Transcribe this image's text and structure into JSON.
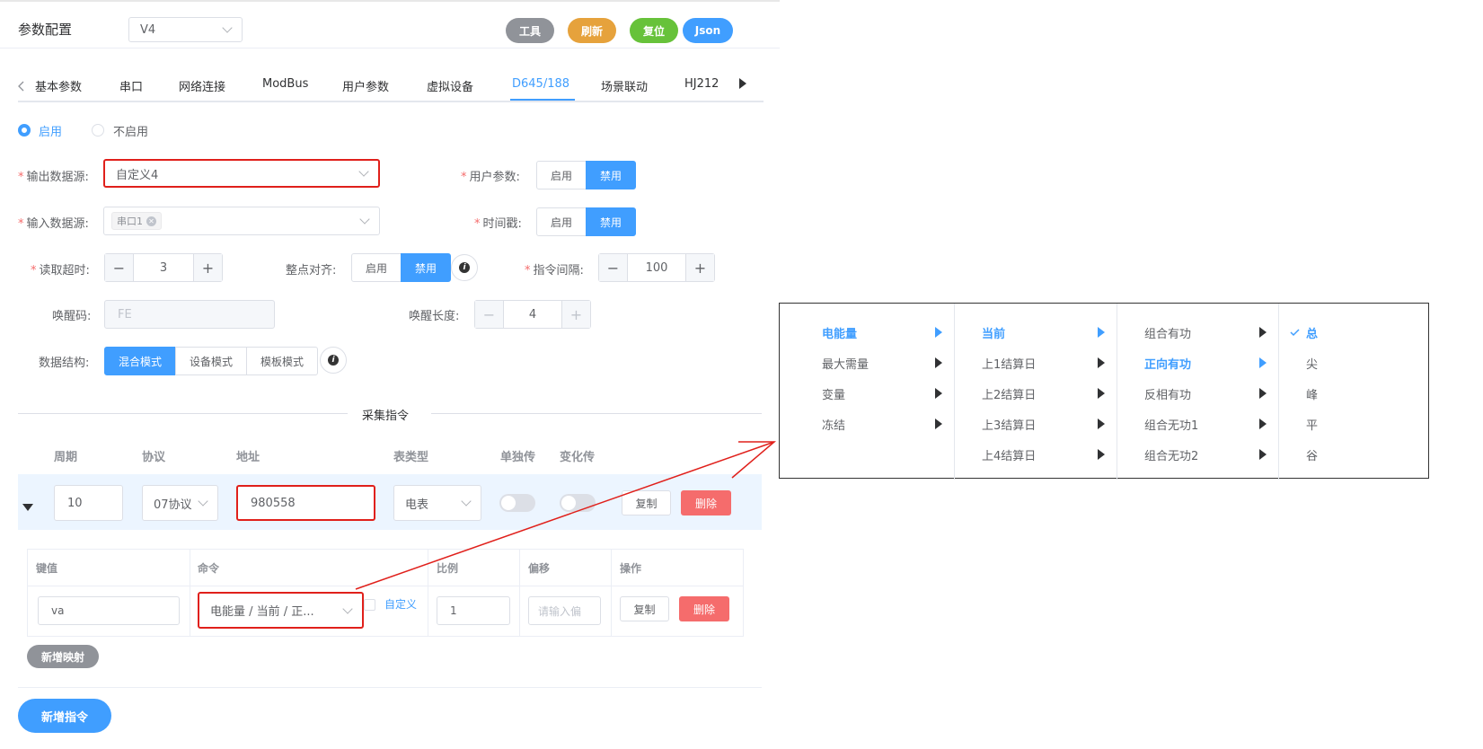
{
  "header": {
    "title": "参数配置",
    "version_select": "V4",
    "buttons": {
      "tools": "工具",
      "refresh": "刷新",
      "reset": "复位",
      "json": "Json"
    },
    "colors": {
      "tools": "#909399",
      "refresh": "#e6a23c",
      "reset": "#67c23a",
      "json": "#409eff"
    }
  },
  "tabs": [
    "基本参数",
    "串口",
    "网络连接",
    "ModBus",
    "用户参数",
    "虚拟设备",
    "D645/188",
    "场景联动",
    "HJ212"
  ],
  "active_tab": "D645/188",
  "enable": {
    "on": "启用",
    "off": "不启用"
  },
  "form": {
    "output_source_label": "输出数据源:",
    "output_source_value": "自定义4",
    "user_param_label": "用户参数:",
    "input_source_label": "输入数据源:",
    "input_source_tag": "串口1",
    "timestamp_label": "时间戳:",
    "read_timeout_label": "读取超时:",
    "read_timeout_value": "3",
    "align_label": "整点对齐:",
    "interval_label": "指令间隔:",
    "interval_value": "100",
    "wake_code_label": "唤醒码:",
    "wake_code_placeholder": "FE",
    "wake_len_label": "唤醒长度:",
    "wake_len_value": "4",
    "data_struct_label": "数据结构:",
    "modes": [
      "混合模式",
      "设备模式",
      "模板模式"
    ],
    "enable_label": "启用",
    "disable_label": "禁用"
  },
  "section_title": "采集指令",
  "cmd_table": {
    "headers": [
      "周期",
      "协议",
      "地址",
      "表类型",
      "单独传",
      "变化传"
    ],
    "row": {
      "period": "10",
      "protocol": "07协议",
      "address": "980558",
      "meter_type": "电表",
      "copy": "复制",
      "delete": "删除"
    }
  },
  "map_table": {
    "headers": [
      "键值",
      "命令",
      "比例",
      "偏移",
      "操作"
    ],
    "row": {
      "key": "va",
      "command": "电能量 / 当前 / 正...",
      "custom": "自定义",
      "ratio": "1",
      "offset_placeholder": "请输入偏",
      "copy": "复制",
      "delete": "删除"
    }
  },
  "add_map": "新增映射",
  "add_cmd": "新增指令",
  "cascader": {
    "col1": [
      "电能量",
      "最大需量",
      "变量",
      "冻结"
    ],
    "col2": [
      "当前",
      "上1结算日",
      "上2结算日",
      "上3结算日",
      "上4结算日"
    ],
    "col3": [
      "组合有功",
      "正向有功",
      "反相有功",
      "组合无功1",
      "组合无功2"
    ],
    "col4": [
      "总",
      "尖",
      "峰",
      "平",
      "谷"
    ]
  }
}
